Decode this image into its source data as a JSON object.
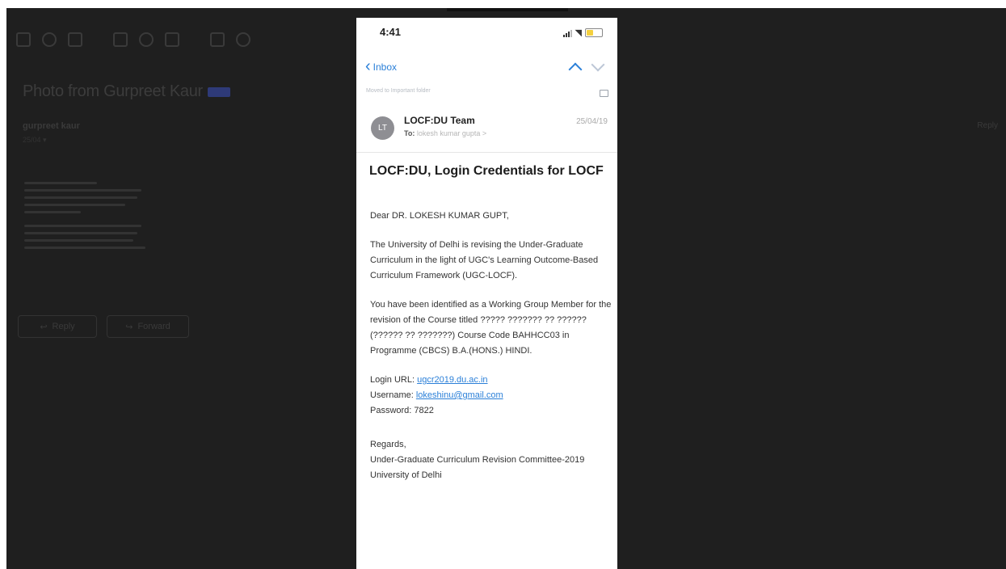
{
  "background": {
    "subject": "Photo from Gurpreet Kaur",
    "sender": "gurpreet kaur",
    "date": "25/04 ▾",
    "right_label": "Reply",
    "reply_label": "Reply",
    "forward_label": "Forward"
  },
  "status_bar": {
    "time": "4:41"
  },
  "nav": {
    "back_label": "Inbox"
  },
  "moved_notice": "Moved to Important folder",
  "email": {
    "avatar_initials": "LT",
    "sender": "LOCF:DU Team",
    "to_label": "To:",
    "to_recipient": "lokesh kumar gupta >",
    "date": "25/04/19",
    "subject": "LOCF:DU, Login Credentials for LOCF",
    "greeting": "Dear DR. LOKESH KUMAR GUPT,",
    "para1": "The University of Delhi is revising the Under-Graduate Curriculum in the light of UGC's Learning Outcome-Based Curriculum Framework (UGC-LOCF).",
    "para2": "You have been identified as a Working Group Member for the revision of the Course titled ????? ??????? ?? ?????? (?????? ?? ???????) Course Code BAHHCC03 in Programme (CBCS) B.A.(HONS.) HINDI.",
    "login_url_label": "Login URL: ",
    "login_url": "ugcr2019.du.ac.in",
    "username_label": "Username: ",
    "username": "lokeshinu@gmail.com",
    "password_line": "Password: 7822",
    "regards": "Regards,",
    "signature": "Under-Graduate Curriculum Revision Committee-2019 University of Delhi"
  },
  "colors": {
    "accent": "#2a7fd8",
    "backdrop": "#1f1f1f",
    "avatar": "#8e8e93"
  }
}
